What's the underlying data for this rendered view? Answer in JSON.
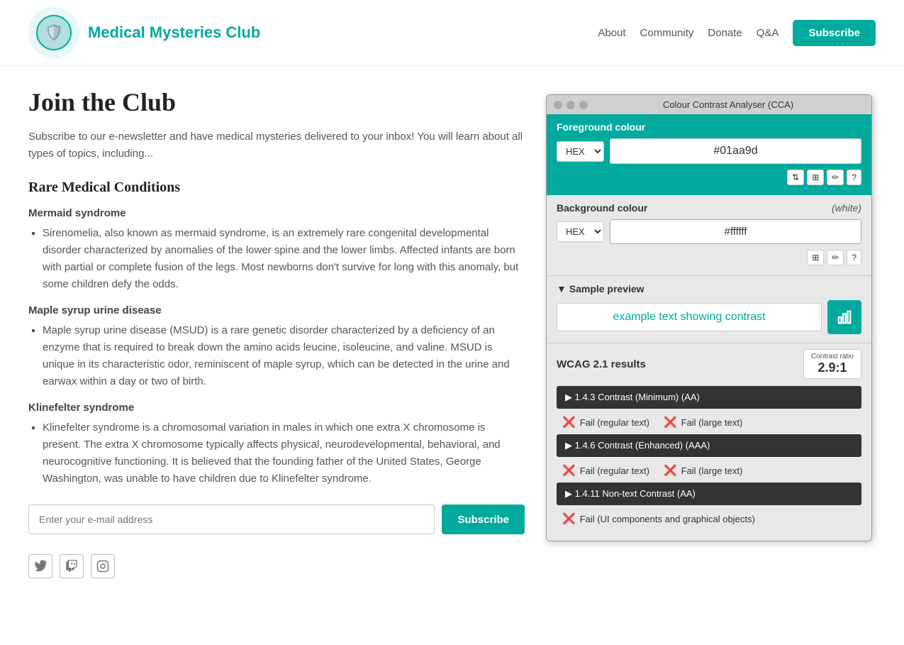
{
  "header": {
    "logo_emoji": "🛡️",
    "site_title": "Medical Mysteries Club",
    "nav": {
      "about": "About",
      "community": "Community",
      "donate": "Donate",
      "qa": "Q&A",
      "subscribe": "Subscribe"
    }
  },
  "main": {
    "page_title": "Join the Club",
    "intro": "Subscribe to our e-newsletter and have medical mysteries delivered to your inbox! You will learn about all types of topics, including...",
    "section_heading": "Rare Medical Conditions",
    "conditions": [
      {
        "title": "Mermaid syndrome",
        "description": "Sirenomelia, also known as mermaid syndrome, is an extremely rare congenital developmental disorder characterized by anomalies of the lower spine and the lower limbs. Affected infants are born with partial or complete fusion of the legs. Most newborns don't survive for long with this anomaly, but some children defy the odds."
      },
      {
        "title": "Maple syrup urine disease",
        "description": "Maple syrup urine disease (MSUD) is a rare genetic disorder characterized by a deficiency of an enzyme that is required to break down the amino acids leucine, isoleucine, and valine. MSUD is unique in its characteristic odor, reminiscent of maple syrup, which can be detected in the urine and earwax within a day or two of birth."
      },
      {
        "title": "Klinefelter syndrome",
        "description": "Klinefelter syndrome is a chromosomal variation in males in which one extra X chromosome is present. The extra X chromosome typically affects physical, neurodevelopmental, behavioral, and neurocognitive functioning. It is believed that the founding father of the United States, George Washington, was unable to have children due to Klinefelter syndrome."
      }
    ],
    "email_placeholder": "Enter your e-mail address",
    "subscribe_btn": "Subscribe"
  },
  "cca": {
    "title": "Colour Contrast Analyser (CCA)",
    "foreground_label": "Foreground colour",
    "fg_format": "HEX",
    "fg_value": "#01aa9d",
    "bg_label": "Background colour",
    "bg_white": "(white)",
    "bg_format": "HEX",
    "bg_value": "#ffffff",
    "preview_label": "▼ Sample preview",
    "sample_text": "example text showing contrast",
    "wcag_label": "WCAG 2.1 results",
    "contrast_ratio_label": "Contrast ratio",
    "contrast_ratio_value": "2.9:1",
    "rules": [
      {
        "id": "1_4_3",
        "label": "▶ 1.4.3 Contrast (Minimum) (AA)",
        "results": [
          {
            "label": "Fail (regular text)"
          },
          {
            "label": "Fail (large text)"
          }
        ]
      },
      {
        "id": "1_4_6",
        "label": "▶ 1.4.6 Contrast (Enhanced) (AAA)",
        "results": [
          {
            "label": "Fail (regular text)"
          },
          {
            "label": "Fail (large text)"
          }
        ]
      },
      {
        "id": "1_4_11",
        "label": "▶ 1.4.11 Non-text Contrast (AA)",
        "results": [
          {
            "label": "Fail (UI components and graphical objects)"
          }
        ]
      }
    ],
    "tools": {
      "arrows": "⇅",
      "grid": "⊞",
      "pen": "✏",
      "help": "?"
    }
  },
  "social": {
    "twitter": "🐦",
    "twitch": "📺",
    "instagram": "📷"
  }
}
